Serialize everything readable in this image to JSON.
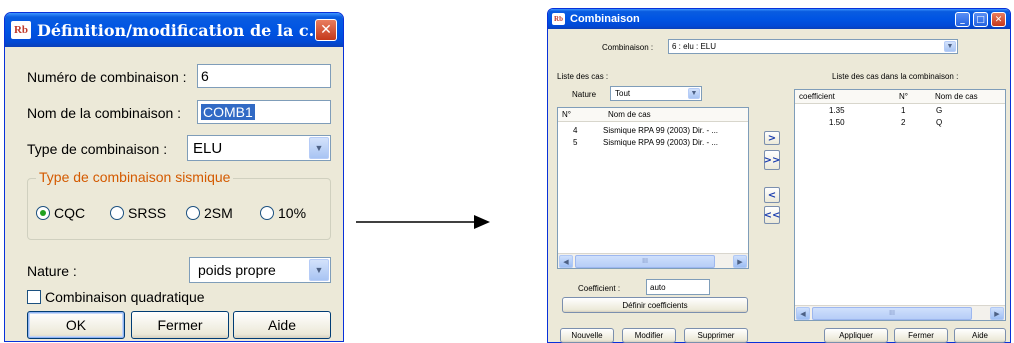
{
  "dialog": {
    "title": "Définition/modification de la c...",
    "icon_text": "Rb",
    "combination_number_label": "Numéro de combinaison :",
    "combination_number_value": "6",
    "combination_name_label": "Nom de la combinaison :",
    "combination_name_value": "COMB1",
    "combination_type_label": "Type de combinaison :",
    "combination_type_value": "ELU",
    "seismic_group_label": "Type de combinaison sismique",
    "seismic_options": [
      "CQC",
      "SRSS",
      "2SM",
      "10%"
    ],
    "seismic_selected": "CQC",
    "nature_label": "Nature :",
    "nature_value": "poids propre",
    "quadratic_label": "Combinaison quadratique",
    "ok_label": "OK",
    "close_label": "Fermer",
    "help_label": "Aide"
  },
  "arrow": {
    "color": "#000000"
  },
  "combi_window": {
    "title": "Combinaison",
    "icon_text": "Rb",
    "combination_label": "Combinaison :",
    "combination_value": "6 : elu : ELU",
    "case_list_label": "Liste des cas :",
    "nature_label": "Nature",
    "nature_value": "Tout",
    "left_columns": [
      "N°",
      "Nom de cas"
    ],
    "left_rows": [
      {
        "n": "4",
        "name": "Sismique RPA 99 (2003) Dir. - ..."
      },
      {
        "n": "5",
        "name": "Sismique RPA 99 (2003) Dir. - ..."
      }
    ],
    "move_buttons": [
      ">",
      ">>",
      "<",
      "<<"
    ],
    "coefficient_label": "Coefficient :",
    "coefficient_value": "auto",
    "define_coefficients_label": "Définir coefficients",
    "right_list_label": "Liste des cas dans la combinaison :",
    "right_columns": [
      "coefficient",
      "N°",
      "Nom de cas"
    ],
    "right_rows": [
      {
        "coef": "1.35",
        "n": "1",
        "name": "G"
      },
      {
        "coef": "1.50",
        "n": "2",
        "name": "Q"
      }
    ],
    "new_label": "Nouvelle",
    "modify_label": "Modifier",
    "delete_label": "Supprimer",
    "apply_label": "Appliquer",
    "close_label": "Fermer",
    "help_label": "Aide"
  }
}
